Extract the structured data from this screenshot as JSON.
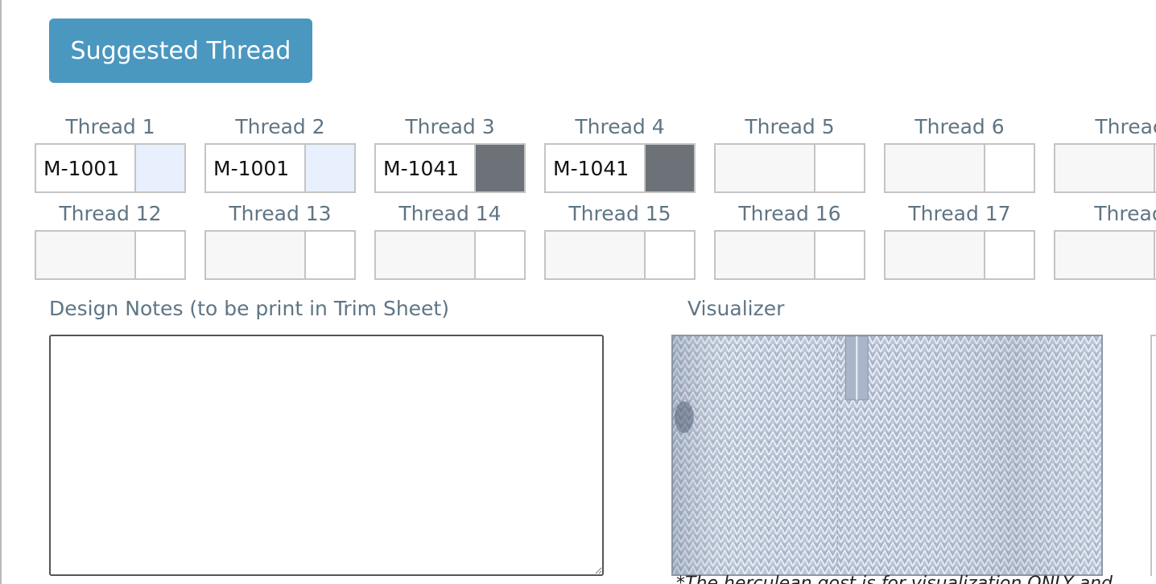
{
  "suggested_button": {
    "label": "Suggested Thread"
  },
  "threads_row1": [
    {
      "label": "Thread 1",
      "code": "M-1001",
      "color": "#e8effd"
    },
    {
      "label": "Thread 2",
      "code": "M-1001",
      "color": "#e8effd"
    },
    {
      "label": "Thread 3",
      "code": "M-1041",
      "color": "#6d7278"
    },
    {
      "label": "Thread 4",
      "code": "M-1041",
      "color": "#6d7278"
    },
    {
      "label": "Thread 5",
      "code": "",
      "color": "#ffffff"
    },
    {
      "label": "Thread 6",
      "code": "",
      "color": "#ffffff"
    },
    {
      "label": "Threac",
      "code": "",
      "color": "#ffffff"
    }
  ],
  "threads_row2": [
    {
      "label": "Thread 12",
      "code": "",
      "color": "#ffffff"
    },
    {
      "label": "Thread 13",
      "code": "",
      "color": "#ffffff"
    },
    {
      "label": "Thread 14",
      "code": "",
      "color": "#ffffff"
    },
    {
      "label": "Thread 15",
      "code": "",
      "color": "#ffffff"
    },
    {
      "label": "Thread 16",
      "code": "",
      "color": "#ffffff"
    },
    {
      "label": "Thread 17",
      "code": "",
      "color": "#ffffff"
    },
    {
      "label": "Thread",
      "code": "",
      "color": "#ffffff"
    }
  ],
  "design_notes": {
    "label": "Design Notes (to be print in Trim Sheet)",
    "value": ""
  },
  "visualizer": {
    "label": "Visualizer",
    "fabric_color": "#b7c2d4",
    "disclaimer": "*The herculean gost is for visualization ONLY and"
  }
}
